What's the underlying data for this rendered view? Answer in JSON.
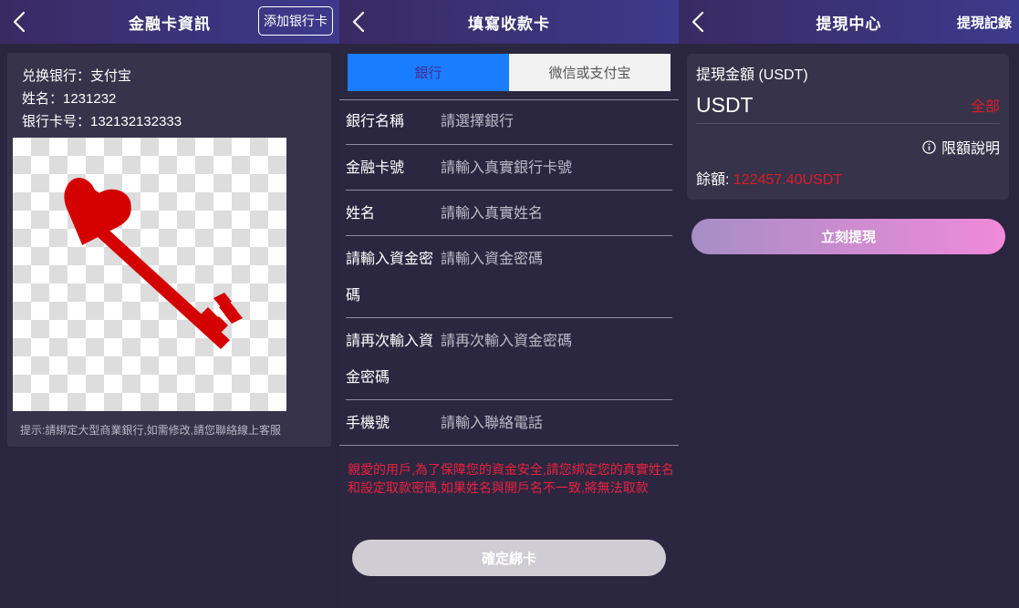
{
  "bank_info": {
    "title": "金融卡資訊",
    "add_button": "添加银行卡",
    "bank_line": "兑换银行：支付宝",
    "name_line": "姓名：1231232",
    "card_line": "银行卡号：132132132333",
    "hint": "提示:請綁定大型商業銀行,如需修改,請您聯絡線上客服",
    "image_icon": "heart-key-icon",
    "accent_red": "#d40000"
  },
  "bind_card": {
    "title": "填寫收款卡",
    "tabs": [
      "銀行",
      "微信或支付宝"
    ],
    "fields": [
      {
        "label": "銀行名稱",
        "placeholder": "請選擇銀行"
      },
      {
        "label": "金融卡號",
        "placeholder": "請輸入真實銀行卡號"
      },
      {
        "label": "姓名",
        "placeholder": "請輸入真實姓名"
      },
      {
        "label_l1": "請輸入資金密",
        "label_l2": "碼",
        "placeholder": "請輸入資金密碼"
      },
      {
        "label_l1": "請再次輸入資",
        "label_l2": "金密碼",
        "placeholder": "請再次輸入資金密碼"
      },
      {
        "label": "手機號",
        "placeholder": "請輸入聯絡電話"
      }
    ],
    "warning": "親愛的用戶,為了保障您的資金安全,請您綁定您的真實姓名和設定取款密碼,如果姓名與開戶名不一致,將無法取款",
    "confirm_button": "確定綁卡",
    "tab_active_color": "#1a7cff"
  },
  "withdraw": {
    "title": "提現中心",
    "history_link": "提現記錄",
    "amount_label": "提現金額 (USDT)",
    "amount_placeholder": "USDT",
    "all_link": "全部",
    "limit_link": "限額說明",
    "balance_label": "餘額:",
    "balance_value": "122457.40USDT",
    "submit_button": "立刻提現",
    "accent_red": "#d81e2a"
  }
}
